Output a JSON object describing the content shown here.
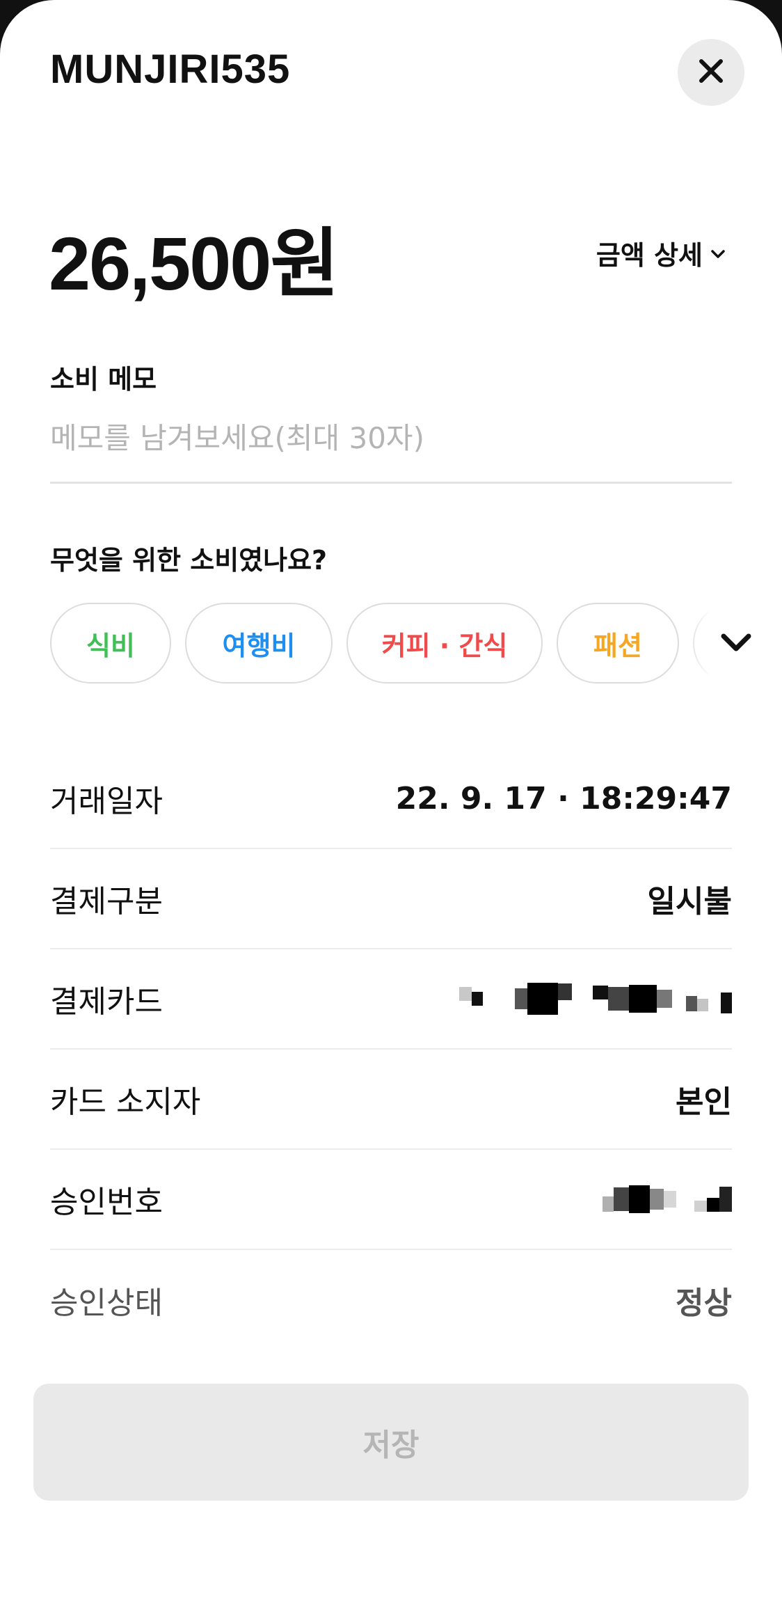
{
  "header": {
    "merchant_name": "MUNJIRI535",
    "close_icon": "close-icon"
  },
  "amount": {
    "value": "26,500원",
    "detail_label": "금액 상세",
    "detail_icon": "chevron-down-icon"
  },
  "memo": {
    "label": "소비 메모",
    "placeholder": "메모를 남겨보세요(최대 30자)",
    "value": ""
  },
  "category": {
    "question": "무엇을 위한 소비였나요?",
    "chips": [
      {
        "label": "식비",
        "color": "#3fbf55"
      },
      {
        "label": "여행비",
        "color": "#1e8ef0"
      },
      {
        "label": "커피 · 간식",
        "color": "#f04a4a"
      },
      {
        "label": "패션",
        "color": "#f5a623"
      }
    ],
    "expand_icon": "chevron-down-icon"
  },
  "details": {
    "rows": [
      {
        "label": "거래일자",
        "value": "22. 9. 17 · 18:29:47"
      },
      {
        "label": "결제구분",
        "value": "일시불"
      },
      {
        "label": "결제카드",
        "value": ""
      },
      {
        "label": "카드 소지자",
        "value": "본인"
      },
      {
        "label": "승인번호",
        "value": ""
      },
      {
        "label": "승인상태",
        "value": "정상"
      }
    ]
  },
  "footer": {
    "save_label": "저장"
  },
  "colors": {
    "background": "#ffffff",
    "text": "#111111",
    "muted": "#b4b4b4",
    "button_bg": "#e9e9e9",
    "button_text": "#b5b5b5"
  }
}
